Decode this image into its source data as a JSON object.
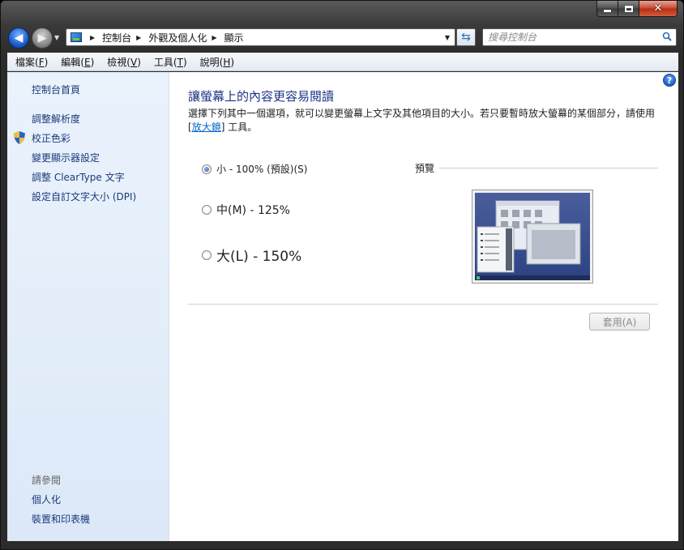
{
  "window": {
    "caption": {
      "minimize": "",
      "maximize": "",
      "close": "✕"
    }
  },
  "address_bar": {
    "crumbs": [
      "控制台",
      "外觀及個人化",
      "顯示"
    ]
  },
  "search": {
    "placeholder": "搜尋控制台"
  },
  "menu": [
    {
      "label": "檔案",
      "key": "F"
    },
    {
      "label": "編輯",
      "key": "E"
    },
    {
      "label": "檢視",
      "key": "V"
    },
    {
      "label": "工具",
      "key": "T"
    },
    {
      "label": "說明",
      "key": "H"
    }
  ],
  "sidebar": {
    "home": "控制台首頁",
    "links": [
      "調整解析度",
      "校正色彩",
      "變更顯示器設定",
      "調整 ClearType 文字",
      "設定自訂文字大小 (DPI)"
    ],
    "see_also_heading": "請參閱",
    "see_also": [
      "個人化",
      "裝置和印表機"
    ]
  },
  "main": {
    "title": "讓螢幕上的內容更容易閱讀",
    "desc_before": "選擇下列其中一個選項，就可以變更螢幕上文字及其他項目的大小。若只要暫時放大螢幕的某個部分，請使用 [",
    "desc_link": "放大鏡",
    "desc_after": "] 工具。",
    "options": [
      {
        "label": "小 - 100% (預設)(S)",
        "checked": true
      },
      {
        "label": "中(M) - 125%",
        "checked": false
      },
      {
        "label": "大(L) - 150%",
        "checked": false
      }
    ],
    "preview_label": "預覽",
    "apply_label": "套用(A)"
  }
}
